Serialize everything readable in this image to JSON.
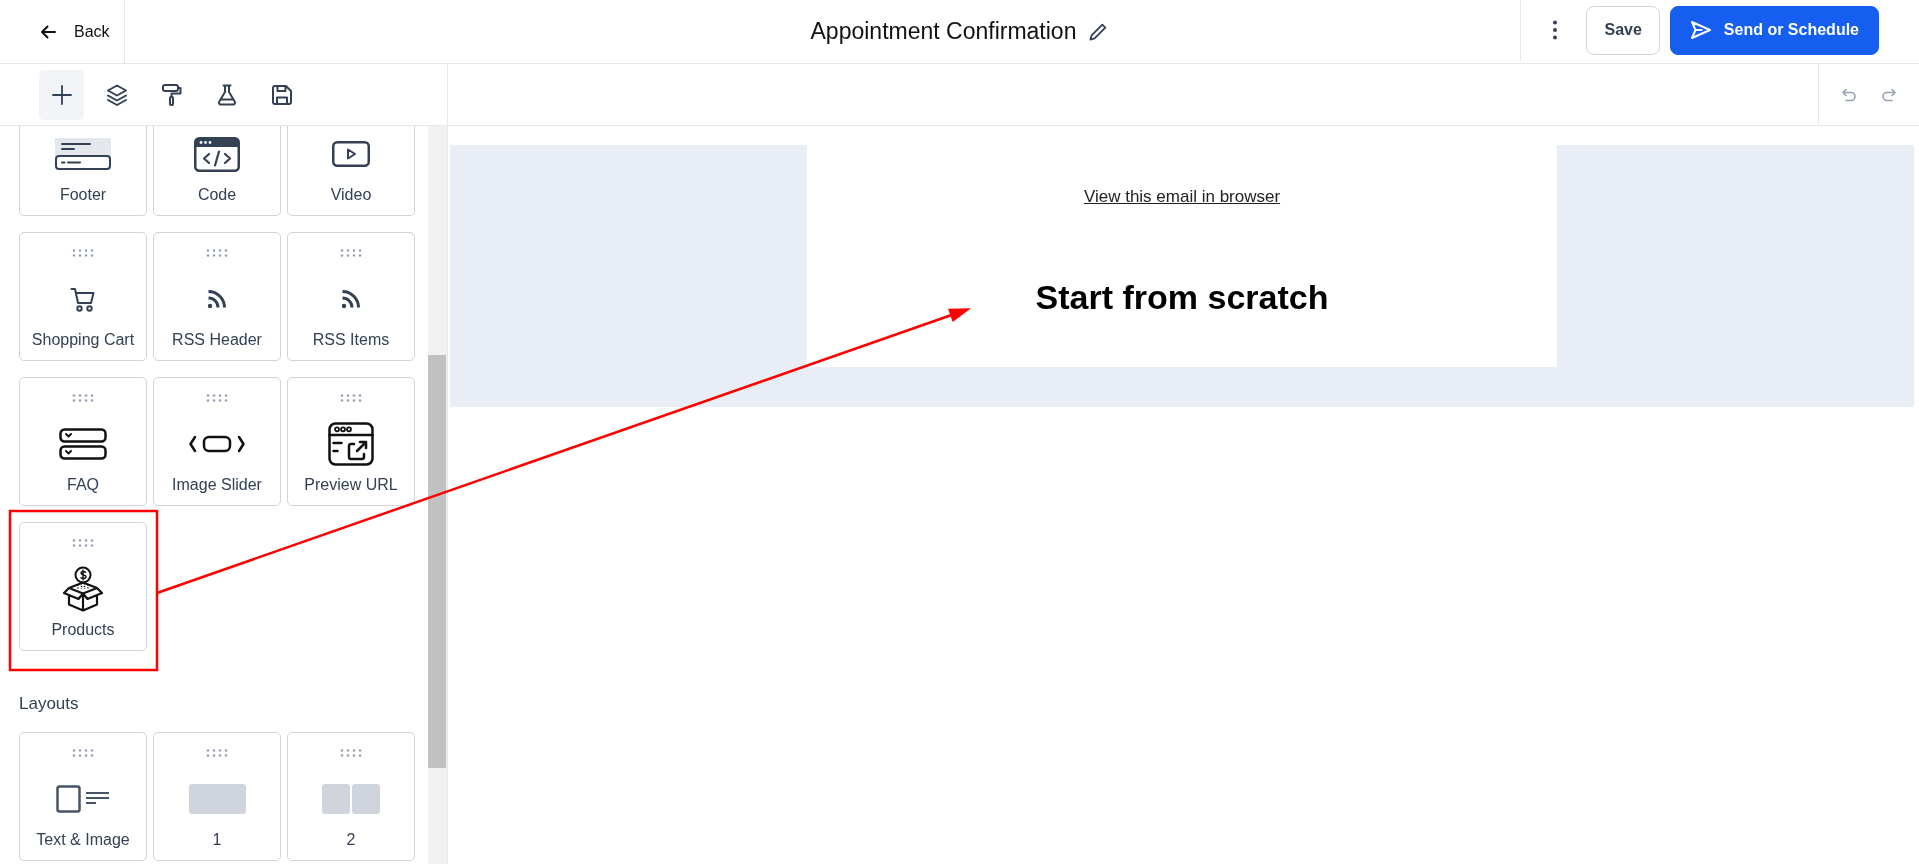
{
  "header": {
    "back": {
      "label": "Back"
    },
    "title": "Appointment Confirmation",
    "buttons": [
      {
        "kind": "secondary",
        "label": "Save"
      },
      {
        "kind": "primary",
        "label": "Send or Schedule"
      }
    ]
  },
  "toolbar": {
    "tools": [
      {
        "kind": "add",
        "selected": true
      },
      {
        "kind": "layers",
        "selected": false
      },
      {
        "kind": "style",
        "selected": false
      },
      {
        "kind": "test",
        "selected": false
      },
      {
        "kind": "save",
        "selected": false
      }
    ],
    "history": [
      {
        "kind": "undo",
        "disabled": true
      },
      {
        "kind": "redo",
        "disabled": true
      }
    ]
  },
  "sidebar": {
    "blocks": [
      {
        "label": "Footer",
        "kind": "footer",
        "cut_off": true,
        "highlighted": false
      },
      {
        "label": "Code",
        "kind": "code",
        "cut_off": true,
        "highlighted": false
      },
      {
        "label": "Video",
        "kind": "video",
        "cut_off": true,
        "highlighted": false
      },
      {
        "label": "Shopping Cart",
        "kind": "cart",
        "cut_off": false,
        "highlighted": false
      },
      {
        "label": "RSS Header",
        "kind": "rss",
        "cut_off": false,
        "highlighted": false
      },
      {
        "label": "RSS Items",
        "kind": "rss",
        "cut_off": false,
        "highlighted": false
      },
      {
        "label": "FAQ",
        "kind": "faq",
        "cut_off": false,
        "highlighted": false
      },
      {
        "label": "Image Slider",
        "kind": "slider",
        "cut_off": false,
        "highlighted": false
      },
      {
        "label": "Preview URL",
        "kind": "preview",
        "cut_off": false,
        "highlighted": false
      },
      {
        "label": "Products",
        "kind": "products",
        "cut_off": false,
        "highlighted": true
      }
    ],
    "layouts_heading": "Layouts",
    "layouts": [
      {
        "label": "Text & Image",
        "kind": "text-image"
      },
      {
        "label": "1",
        "kind": "one-column"
      },
      {
        "label": "2",
        "kind": "two-column"
      }
    ]
  },
  "canvas": {
    "browser_link": "View this email in browser",
    "heading": "Start from scratch"
  }
}
